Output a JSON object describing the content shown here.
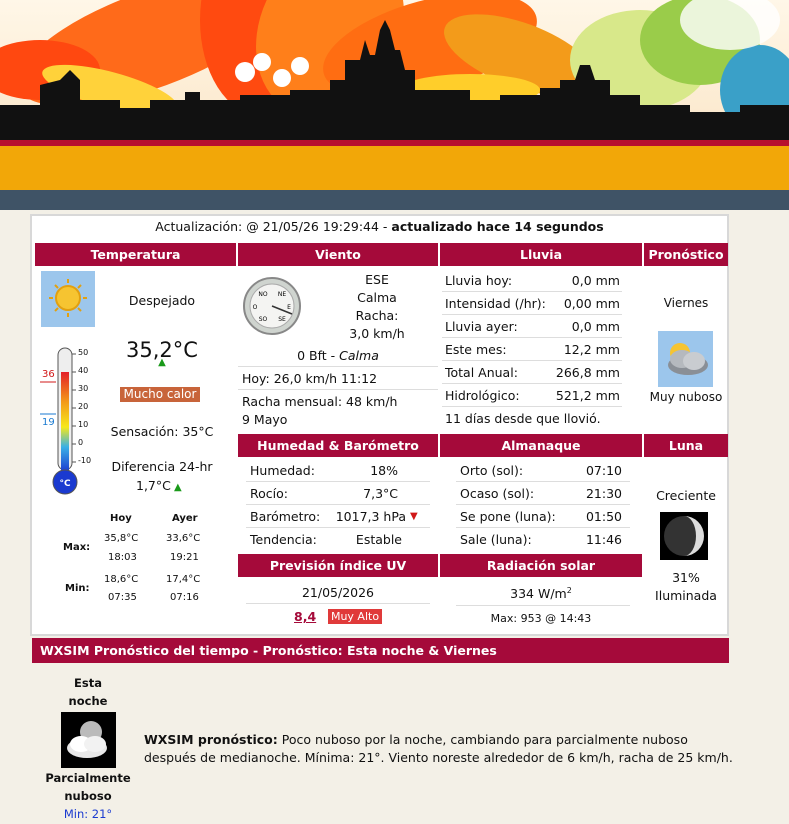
{
  "update": {
    "label": "Actualización: @ 21/05/26 19:29:44 - ",
    "ago": "actualizado hace 14 segundos"
  },
  "temperature": {
    "header": "Temperatura",
    "condition": "Despejado",
    "value": "35,2°C",
    "badge": "Mucho calor",
    "feels": "Sensación: 35°C",
    "diff_label": "Diferencia 24-hr",
    "diff_value": "1,7°C",
    "therm_max": "36",
    "therm_min": "19",
    "therm_unit": "°C",
    "therm_ticks": [
      "50",
      "40",
      "30",
      "20",
      "10",
      "0",
      "-10"
    ],
    "col_today": "Hoy",
    "col_yesterday": "Ayer",
    "max_label": "Max:",
    "min_label": "Min:",
    "today_max": "35,8°C",
    "today_max_time": "18:03",
    "yest_max": "33,6°C",
    "yest_max_time": "19:21",
    "today_min": "18,6°C",
    "today_min_time": "07:35",
    "yest_min": "17,4°C",
    "yest_min_time": "07:16"
  },
  "wind": {
    "header": "Viento",
    "dir": "ESE",
    "calm": "Calma",
    "gust_label": "Racha:",
    "gust_value": "3,0 km/h",
    "bft": "0 Bft - ",
    "bft_desc": "Calma",
    "today": "Hoy: 26,0 km/h 11:12",
    "monthly_line1": "Racha mensual: 48 km/h",
    "monthly_line2": "9 Mayo",
    "compass": [
      "NO",
      "NE",
      "O",
      "E",
      "SO",
      "SE"
    ]
  },
  "rain": {
    "header": "Lluvia",
    "rows": [
      {
        "label": "Lluvia hoy:",
        "value": "0,0 mm"
      },
      {
        "label": "Intensidad (/hr):",
        "value": "0,00 mm"
      },
      {
        "label": "Lluvia ayer:",
        "value": "0,0 mm"
      },
      {
        "label": "Este mes:",
        "value": "12,2 mm"
      },
      {
        "label": "Total Anual:",
        "value": "266,8 mm"
      },
      {
        "label": "Hidrológico:",
        "value": "521,2 mm"
      }
    ],
    "since": "11 días desde que llovió."
  },
  "forecast": {
    "header": "Pronóstico",
    "day": "Viernes",
    "desc": "Muy nuboso"
  },
  "humidity": {
    "header": "Humedad & Barómetro",
    "rows": [
      {
        "label": "Humedad:",
        "value": "18%"
      },
      {
        "label": "Rocío:",
        "value": "7,3°C"
      },
      {
        "label": "Barómetro:",
        "value": "1017,3 hPa"
      },
      {
        "label": "Tendencia:",
        "value": "Estable"
      }
    ]
  },
  "almanac": {
    "header": "Almanaque",
    "rows": [
      {
        "label": "Orto (sol):",
        "value": "07:10"
      },
      {
        "label": "Ocaso (sol):",
        "value": "21:30"
      },
      {
        "label": "Se pone (luna):",
        "value": "01:50"
      },
      {
        "label": "Sale (luna):",
        "value": "11:46"
      }
    ]
  },
  "moon": {
    "header": "Luna",
    "phase": "Creciente",
    "pct": "31%",
    "lit": "Iluminada"
  },
  "uv": {
    "header": "Previsión índice UV",
    "date": "21/05/2026",
    "value": "8,4",
    "level": "Muy Alto"
  },
  "solar": {
    "header": "Radiación solar",
    "value": "334 W/m",
    "sup": "2",
    "max": "Max: 953 @  14:43"
  },
  "wxsim": {
    "bar": "WXSIM Pronóstico del tiempo  - Pronóstico: Esta noche & Viernes",
    "period1": "Esta",
    "period2": "noche",
    "cond1": "Parcialmente",
    "cond2": "nuboso",
    "min": "Min: 21°",
    "label": "WXSIM pronóstico:",
    "text": " Poco nuboso por la noche, cambiando para parcialmente nuboso después de medianoche. Mínima: 21°. Viento noreste alrededor de 6 km/h, racha de 25 km/h."
  },
  "colors": {
    "header": "#a50a3a",
    "badge": "#c8643a",
    "uvbadge": "#e03a3a",
    "link": "#a50a3a",
    "min": "#1a3ad0"
  }
}
